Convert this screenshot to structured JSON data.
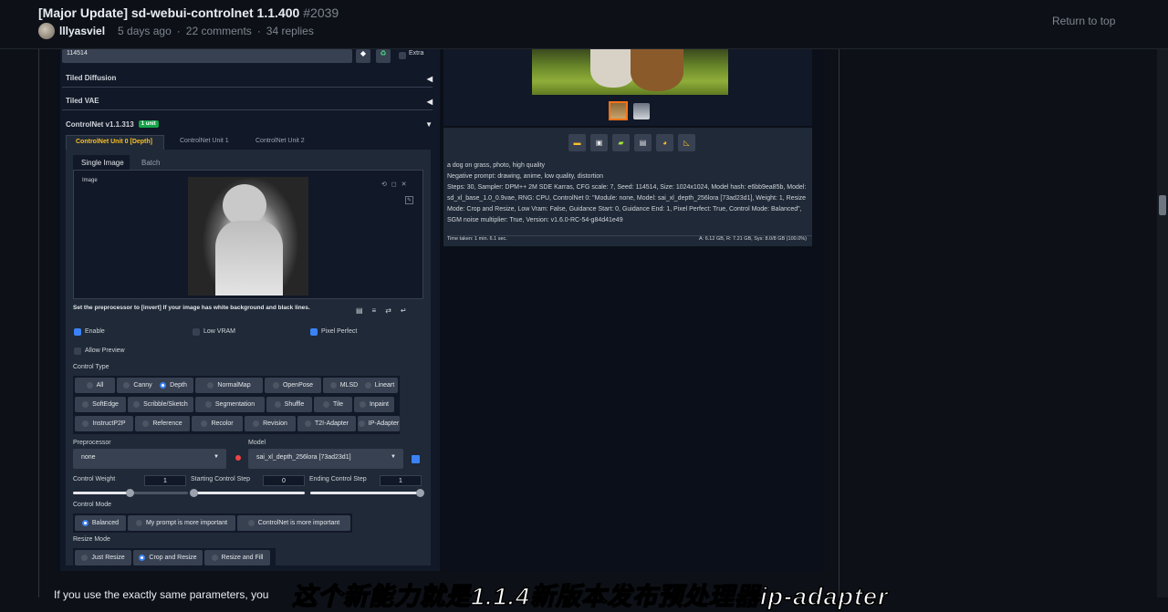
{
  "header": {
    "title": "[Major Update] sd-webui-controlnet 1.1.400",
    "issue_number": "#2039",
    "author": "lllyasviel",
    "time_ago": "5 days ago",
    "comments": "22 comments",
    "replies": "34 replies",
    "return_to_top": "Return to top"
  },
  "webui": {
    "seed": "114514",
    "extra_label": "Extra",
    "sections": [
      "Tiled Diffusion",
      "Tiled VAE"
    ],
    "controlnet": {
      "title": "ControlNet v1.1.313",
      "badge": "1 unit",
      "unit_tabs": [
        "ControlNet Unit 0 [Depth]",
        "ControlNet Unit 1",
        "ControlNet Unit 2"
      ],
      "image_tabs": [
        "Single Image",
        "Batch"
      ],
      "image_label": "Image",
      "hint": "Set the preprocessor to [invert] If your image has white background and black lines.",
      "enable": "Enable",
      "low_vram": "Low VRAM",
      "pixel_perfect": "Pixel Perfect",
      "allow_preview": "Allow Preview",
      "control_type_label": "Control Type",
      "control_types_row1": [
        "All",
        "Canny",
        "Depth",
        "NormalMap",
        "OpenPose",
        "MLSD",
        "Lineart"
      ],
      "control_types_row2": [
        "SoftEdge",
        "Scribble/Sketch",
        "Segmentation",
        "Shuffle",
        "Tile",
        "Inpaint"
      ],
      "control_types_row3": [
        "InstructP2P",
        "Reference",
        "Recolor",
        "Revision",
        "T2I-Adapter",
        "IP-Adapter"
      ],
      "selected_control_type": "Depth",
      "preprocessor_label": "Preprocessor",
      "preprocessor_value": "none",
      "model_label": "Model",
      "model_value": "sai_xl_depth_256lora [73ad23d1]",
      "control_weight_label": "Control Weight",
      "control_weight": "1",
      "start_step_label": "Starting Control Step",
      "start_step": "0",
      "end_step_label": "Ending Control Step",
      "end_step": "1",
      "control_mode_label": "Control Mode",
      "control_modes": [
        "Balanced",
        "My prompt is more important",
        "ControlNet is more important"
      ],
      "resize_mode_label": "Resize Mode",
      "resize_modes": [
        "Just Resize",
        "Crop and Resize",
        "Resize and Fill"
      ]
    },
    "output": {
      "prompt": "a dog on grass, photo, high quality",
      "negative": "Negative prompt: drawing, anime, low quality, distortion",
      "params_line1": "Steps: 30, Sampler: DPM++ 2M SDE Karras, CFG scale: 7, Seed: 114514, Size: 1024x1024, Model hash: e6bb9ea85b, Model:",
      "params_line2": "sd_xl_base_1.0_0.9vae, RNG: CPU, ControlNet 0: \"Module: none, Model: sai_xl_depth_256lora [73ad23d1], Weight: 1, Resize",
      "params_line3": "Mode: Crop and Resize, Low Vram: False, Guidance Start: 0, Guidance End: 1, Pixel Perfect: True, Control Mode: Balanced\",",
      "params_line4": "SGM noise multiplier: True, Version: v1.6.0-RC-54-g84d41e49",
      "time_taken": "Time taken: 1 min. 6.1 sec.",
      "vram": "A: 6.12 GB, R: 7.21 GB, Sys: 8.0/8 GB (100.0%)"
    }
  },
  "comment_text": "If you use the exactly same parameters, you",
  "subtitle": "这个新能力就是1.1.4新版本发布预处理器ip-adapter"
}
